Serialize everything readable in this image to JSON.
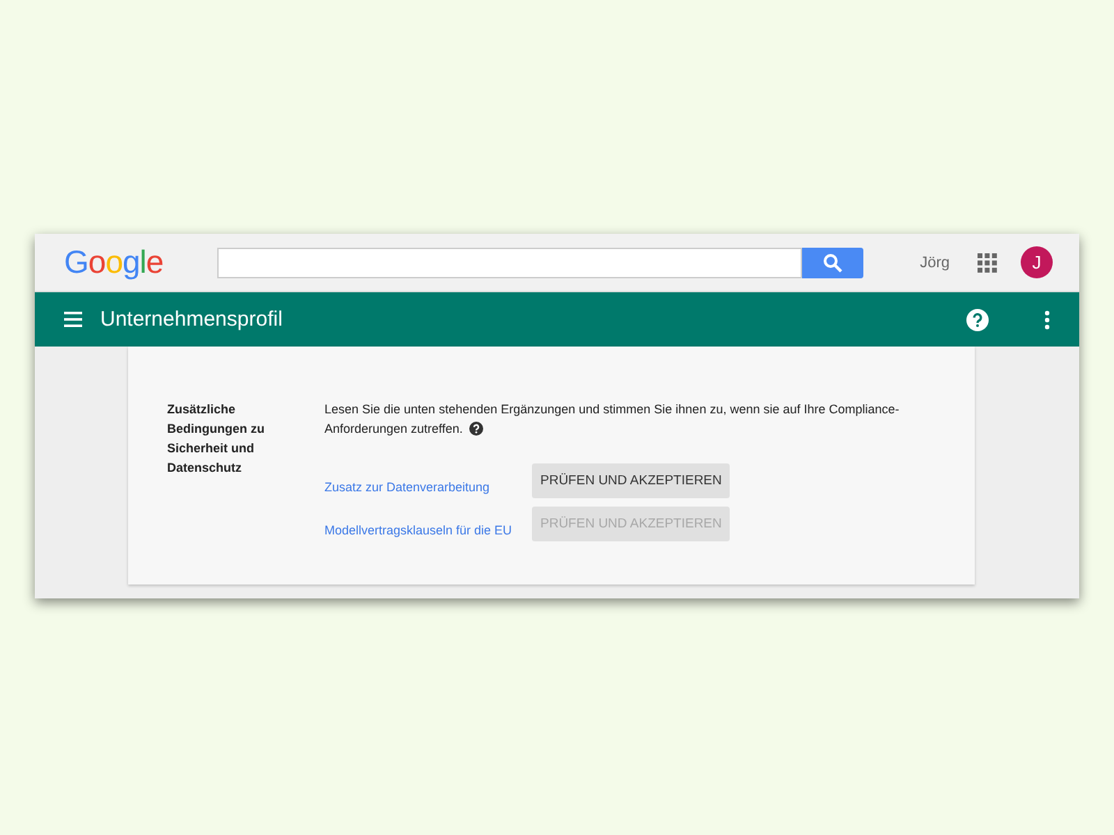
{
  "header": {
    "logo": "Google",
    "user_name": "Jörg",
    "avatar_letter": "J"
  },
  "appbar": {
    "title": "Unternehmensprofil"
  },
  "section": {
    "label": "Zusätzliche Bedingungen zu Sicherheit und Datenschutz",
    "description_lines": [
      "Lesen Sie die unten stehenden Ergänzungen und stimmen Sie ihnen zu, wenn sie auf Ihre Compliance-",
      "Anforderungen zutreffen."
    ],
    "items": [
      {
        "link": "Zusatz zur Datenverarbeitung",
        "button": "PRÜFEN UND AKZEPTIEREN",
        "disabled": false
      },
      {
        "link": "Modellvertragsklauseln für die EU",
        "button": "PRÜFEN UND AKZEPTIEREN",
        "disabled": true
      }
    ]
  }
}
